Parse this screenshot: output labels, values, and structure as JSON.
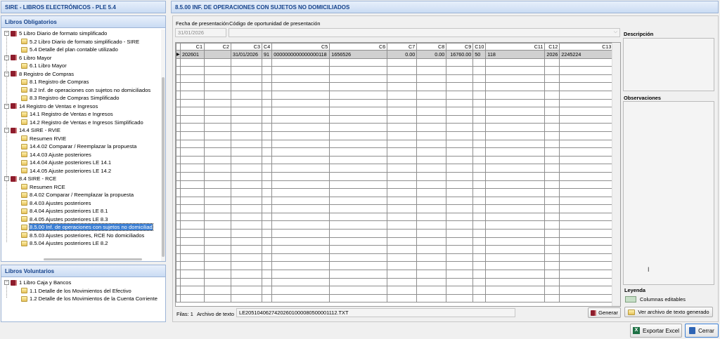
{
  "app_title": "SIRE - LIBROS ELECTRÓNICOS - PLE 5.4",
  "main_title": "8.5.00 INF. DE OPERACIONES CON SUJETOS NO DOMICILIADOS",
  "libros_obligatorios": {
    "header": "Libros Obligatorios",
    "items": [
      {
        "label": "5 Libro Diario de formato simplificado",
        "level": 0,
        "icon": "book-icon"
      },
      {
        "label": "5.2 Libro Diario de formato simplificado - SIRE",
        "level": 1,
        "icon": "folder-icon"
      },
      {
        "label": "5.4 Detalle del plan contable utilizado",
        "level": 1,
        "icon": "folder-icon"
      },
      {
        "label": "6 Libro Mayor",
        "level": 0,
        "icon": "book-icon"
      },
      {
        "label": "6.1 Libro Mayor",
        "level": 1,
        "icon": "folder-icon"
      },
      {
        "label": "8 Registro de Compras",
        "level": 0,
        "icon": "book-icon"
      },
      {
        "label": "8.1 Registro de Compras",
        "level": 1,
        "icon": "folder-icon"
      },
      {
        "label": "8.2 Inf. de operaciones con sujetos no domiciliados",
        "level": 1,
        "icon": "folder-icon"
      },
      {
        "label": "8.3 Registro de Compras Simplificado",
        "level": 1,
        "icon": "folder-icon"
      },
      {
        "label": "14 Registro de Ventas e Ingresos",
        "level": 0,
        "icon": "book-icon"
      },
      {
        "label": "14.1 Registro de Ventas e Ingresos",
        "level": 1,
        "icon": "folder-icon"
      },
      {
        "label": "14.2 Registro de Ventas e Ingresos Simplificado",
        "level": 1,
        "icon": "folder-icon"
      },
      {
        "label": "14.4 SIRE - RVIE",
        "level": 0,
        "icon": "book-icon"
      },
      {
        "label": "Resumen RVIE",
        "level": 1,
        "icon": "folder-icon"
      },
      {
        "label": "14.4.02 Comparar / Reemplazar la propuesta",
        "level": 1,
        "icon": "folder-icon"
      },
      {
        "label": "14.4.03 Ajuste posteriores",
        "level": 1,
        "icon": "folder-icon"
      },
      {
        "label": "14.4.04 Ajuste posteriores  LE 14.1",
        "level": 1,
        "icon": "folder-icon"
      },
      {
        "label": "14.4.05 Ajuste posteriores  LE 14.2",
        "level": 1,
        "icon": "folder-icon"
      },
      {
        "label": "8.4 SIRE - RCE",
        "level": 0,
        "icon": "book-icon"
      },
      {
        "label": "Resumen RCE",
        "level": 1,
        "icon": "folder-icon"
      },
      {
        "label": "8.4.02 Comparar / Reemplazar la propuesta",
        "level": 1,
        "icon": "folder-icon"
      },
      {
        "label": "8.4.03 Ajustes posteriores",
        "level": 1,
        "icon": "folder-icon"
      },
      {
        "label": "8.4.04 Ajustes posteriores LE 8.1",
        "level": 1,
        "icon": "folder-icon"
      },
      {
        "label": "8.4.05 Ajustes posteriores LE 8.3",
        "level": 1,
        "icon": "folder-icon"
      },
      {
        "label": "8.5.00 Inf. de operaciones con sujetos no domiciliad",
        "level": 1,
        "icon": "folder-icon",
        "selected": true
      },
      {
        "label": "8.5.03 Ajustes posteriores, RCE No domiciliados",
        "level": 1,
        "icon": "folder-icon"
      },
      {
        "label": "8.5.04 Ajustes posteriores LE 8.2",
        "level": 1,
        "icon": "folder-icon"
      }
    ]
  },
  "libros_voluntarios": {
    "header": "Libros Voluntarios",
    "items": [
      {
        "label": "1 Libro Caja y Bancos",
        "level": 0,
        "icon": "book-icon"
      },
      {
        "label": "1.1 Detalle de los Movimientos del Efectivo",
        "level": 1,
        "icon": "folder-icon"
      },
      {
        "label": "1.2 Detalle de los Movimientos de la Cuenta Corriente",
        "level": 1,
        "icon": "folder-icon"
      }
    ]
  },
  "form": {
    "fecha_label": "Fecha de presentación",
    "fecha_value": "31/01/2026",
    "codigo_label": "Código de oportunidad de presentación",
    "codigo_value": ""
  },
  "grid": {
    "columns": [
      "C1",
      "C2",
      "C3",
      "C4",
      "C5",
      "C6",
      "C7",
      "C8",
      "C9",
      "C10",
      "C11",
      "C12",
      "C13"
    ],
    "row": [
      "202601",
      "",
      "31/01/2026",
      "91",
      "0000000000000000118",
      "1656526",
      "0.00",
      "0.00",
      "16760.00",
      "50",
      "118",
      "2026",
      "2245224"
    ],
    "row_indicator": "▶"
  },
  "footer": {
    "filas_label": "Filas:",
    "filas_value": "1",
    "archivo_label": "Archivo de texto",
    "archivo_value": "LE20510406274202601000080500001112.TXT",
    "generar_label": "Generar"
  },
  "side": {
    "descripcion_label": "Descripción",
    "observaciones_label": "Observaciones",
    "leyenda_label": "Leyenda",
    "columnas_editables_label": "Columnas editables",
    "ver_archivo_label": "Ver archivo de texto generado"
  },
  "bottom_buttons": {
    "exportar_label": "Exportar Excel",
    "cerrar_label": "Cerrar"
  }
}
